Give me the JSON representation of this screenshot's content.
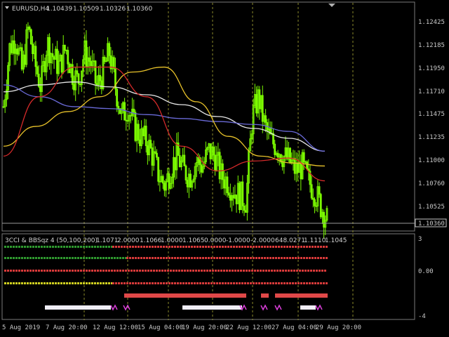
{
  "main_header": {
    "symbol_label": "EURUSD,H4",
    "o": "1.10439",
    "h": "1.10509",
    "l": "1.10326",
    "c": "1.10360"
  },
  "indicator_header": {
    "name": "3CCI & BBSqz 4 (50,100,200)",
    "values": [
      "1.1071",
      "2.0000",
      "1.1066",
      "1.0000",
      "1.1065",
      "0.0000",
      "-1.0000",
      "-2.0000",
      "648.0271",
      "1.1110",
      "1.1045"
    ]
  },
  "price_axis": {
    "ticks": [
      "1.12425",
      "1.12185",
      "1.11950",
      "1.11710",
      "1.11475",
      "1.11235",
      "1.11000",
      "1.10760",
      "1.10525"
    ],
    "current_price": "1.10360"
  },
  "indicator_axis": {
    "ticks": [
      "3",
      "0.00",
      "-4"
    ]
  },
  "time_axis": {
    "labels": [
      "5 Aug 2019",
      "7 Aug 20:00",
      "12 Aug 12:00",
      "15 Aug 04:00",
      "19 Aug 20:00",
      "22 Aug 12:00",
      "27 Aug 04:00",
      "29 Aug 20:00"
    ]
  },
  "colors": {
    "candle": "#7cfc00",
    "ma_white": "#e6e6e6",
    "ma_blue": "#6a6ad8",
    "ma_yellow": "#e8c22a",
    "ma_red": "#d42a2a",
    "grid": "#8a8a2a",
    "dots_green": "#2f9a2f",
    "dots_red": "#d83a3a",
    "dots_yellow": "#d0d020",
    "bar_red": "#e04848",
    "bar_white": "#f0eef8",
    "wave_pink": "#e040e0"
  },
  "chart_data": {
    "type": "candlestick",
    "symbol": "EURUSD",
    "timeframe": "H4",
    "ylim": [
      1.1025,
      1.1255
    ],
    "ohlc_last": {
      "open": 1.10439,
      "high": 1.10509,
      "low": 1.10326,
      "close": 1.1036
    },
    "close_path": [
      1.115,
      1.121,
      1.122,
      1.1185,
      1.123,
      1.1195,
      1.117,
      1.1215,
      1.12,
      1.119,
      1.121,
      1.1185,
      1.1175,
      1.1205,
      1.1195,
      1.117,
      1.1185,
      1.1205,
      1.117,
      1.114,
      1.115,
      1.113,
      1.112,
      1.1115,
      1.11,
      1.108,
      1.107,
      1.109,
      1.11,
      1.1085,
      1.108,
      1.1095,
      1.109,
      1.1105,
      1.11,
      1.108,
      1.1075,
      1.1065,
      1.106,
      1.1055,
      1.114,
      1.116,
      1.113,
      1.1115,
      1.111,
      1.11,
      1.1095,
      1.1085,
      1.109,
      1.1075,
      1.1065,
      1.105,
      1.1036
    ],
    "series": [
      {
        "values": [
          1.1165,
          1.1172,
          1.1175,
          1.117,
          1.1162,
          1.1152,
          1.114,
          1.1128,
          1.1118,
          1.1105
        ]
      },
      {
        "values": [
          1.1172,
          1.116,
          1.115,
          1.1148,
          1.1142,
          1.1138,
          1.1135,
          1.1132,
          1.1125,
          1.1105
        ]
      },
      {
        "values": [
          1.111,
          1.113,
          1.1145,
          1.116,
          1.1185,
          1.119,
          1.1155,
          1.112,
          1.11,
          1.1093,
          1.109
        ]
      },
      {
        "values": [
          1.11,
          1.116,
          1.119,
          1.119,
          1.116,
          1.111,
          1.1085,
          1.1095,
          1.1098,
          1.1075
        ]
      }
    ]
  }
}
